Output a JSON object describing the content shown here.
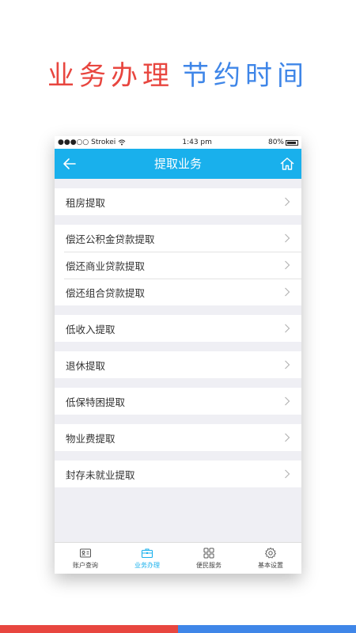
{
  "headline": {
    "red_text": "业务办理",
    "blue_text": "节约时间"
  },
  "statusbar": {
    "carrier": "●●●○○ Strokei",
    "time": "1:43 pm",
    "battery": "80%"
  },
  "navbar": {
    "title": "提取业务"
  },
  "groups": [
    [
      "租房提取"
    ],
    [
      "偿还公积金贷款提取",
      "偿还商业贷款提取",
      "偿还组合贷款提取"
    ],
    [
      "低收入提取"
    ],
    [
      "退休提取"
    ],
    [
      "低保特困提取"
    ],
    [
      "物业费提取"
    ],
    [
      "封存未就业提取"
    ]
  ],
  "tabs": [
    {
      "label": "账户查询",
      "icon": "id-card-icon",
      "active": false
    },
    {
      "label": "业务办理",
      "icon": "briefcase-icon",
      "active": true
    },
    {
      "label": "便民服务",
      "icon": "grid-icon",
      "active": false
    },
    {
      "label": "基本设置",
      "icon": "gear-icon",
      "active": false
    }
  ],
  "colors": {
    "accent": "#19b0ec",
    "red": "#e8463f",
    "blue": "#3f86e8"
  }
}
